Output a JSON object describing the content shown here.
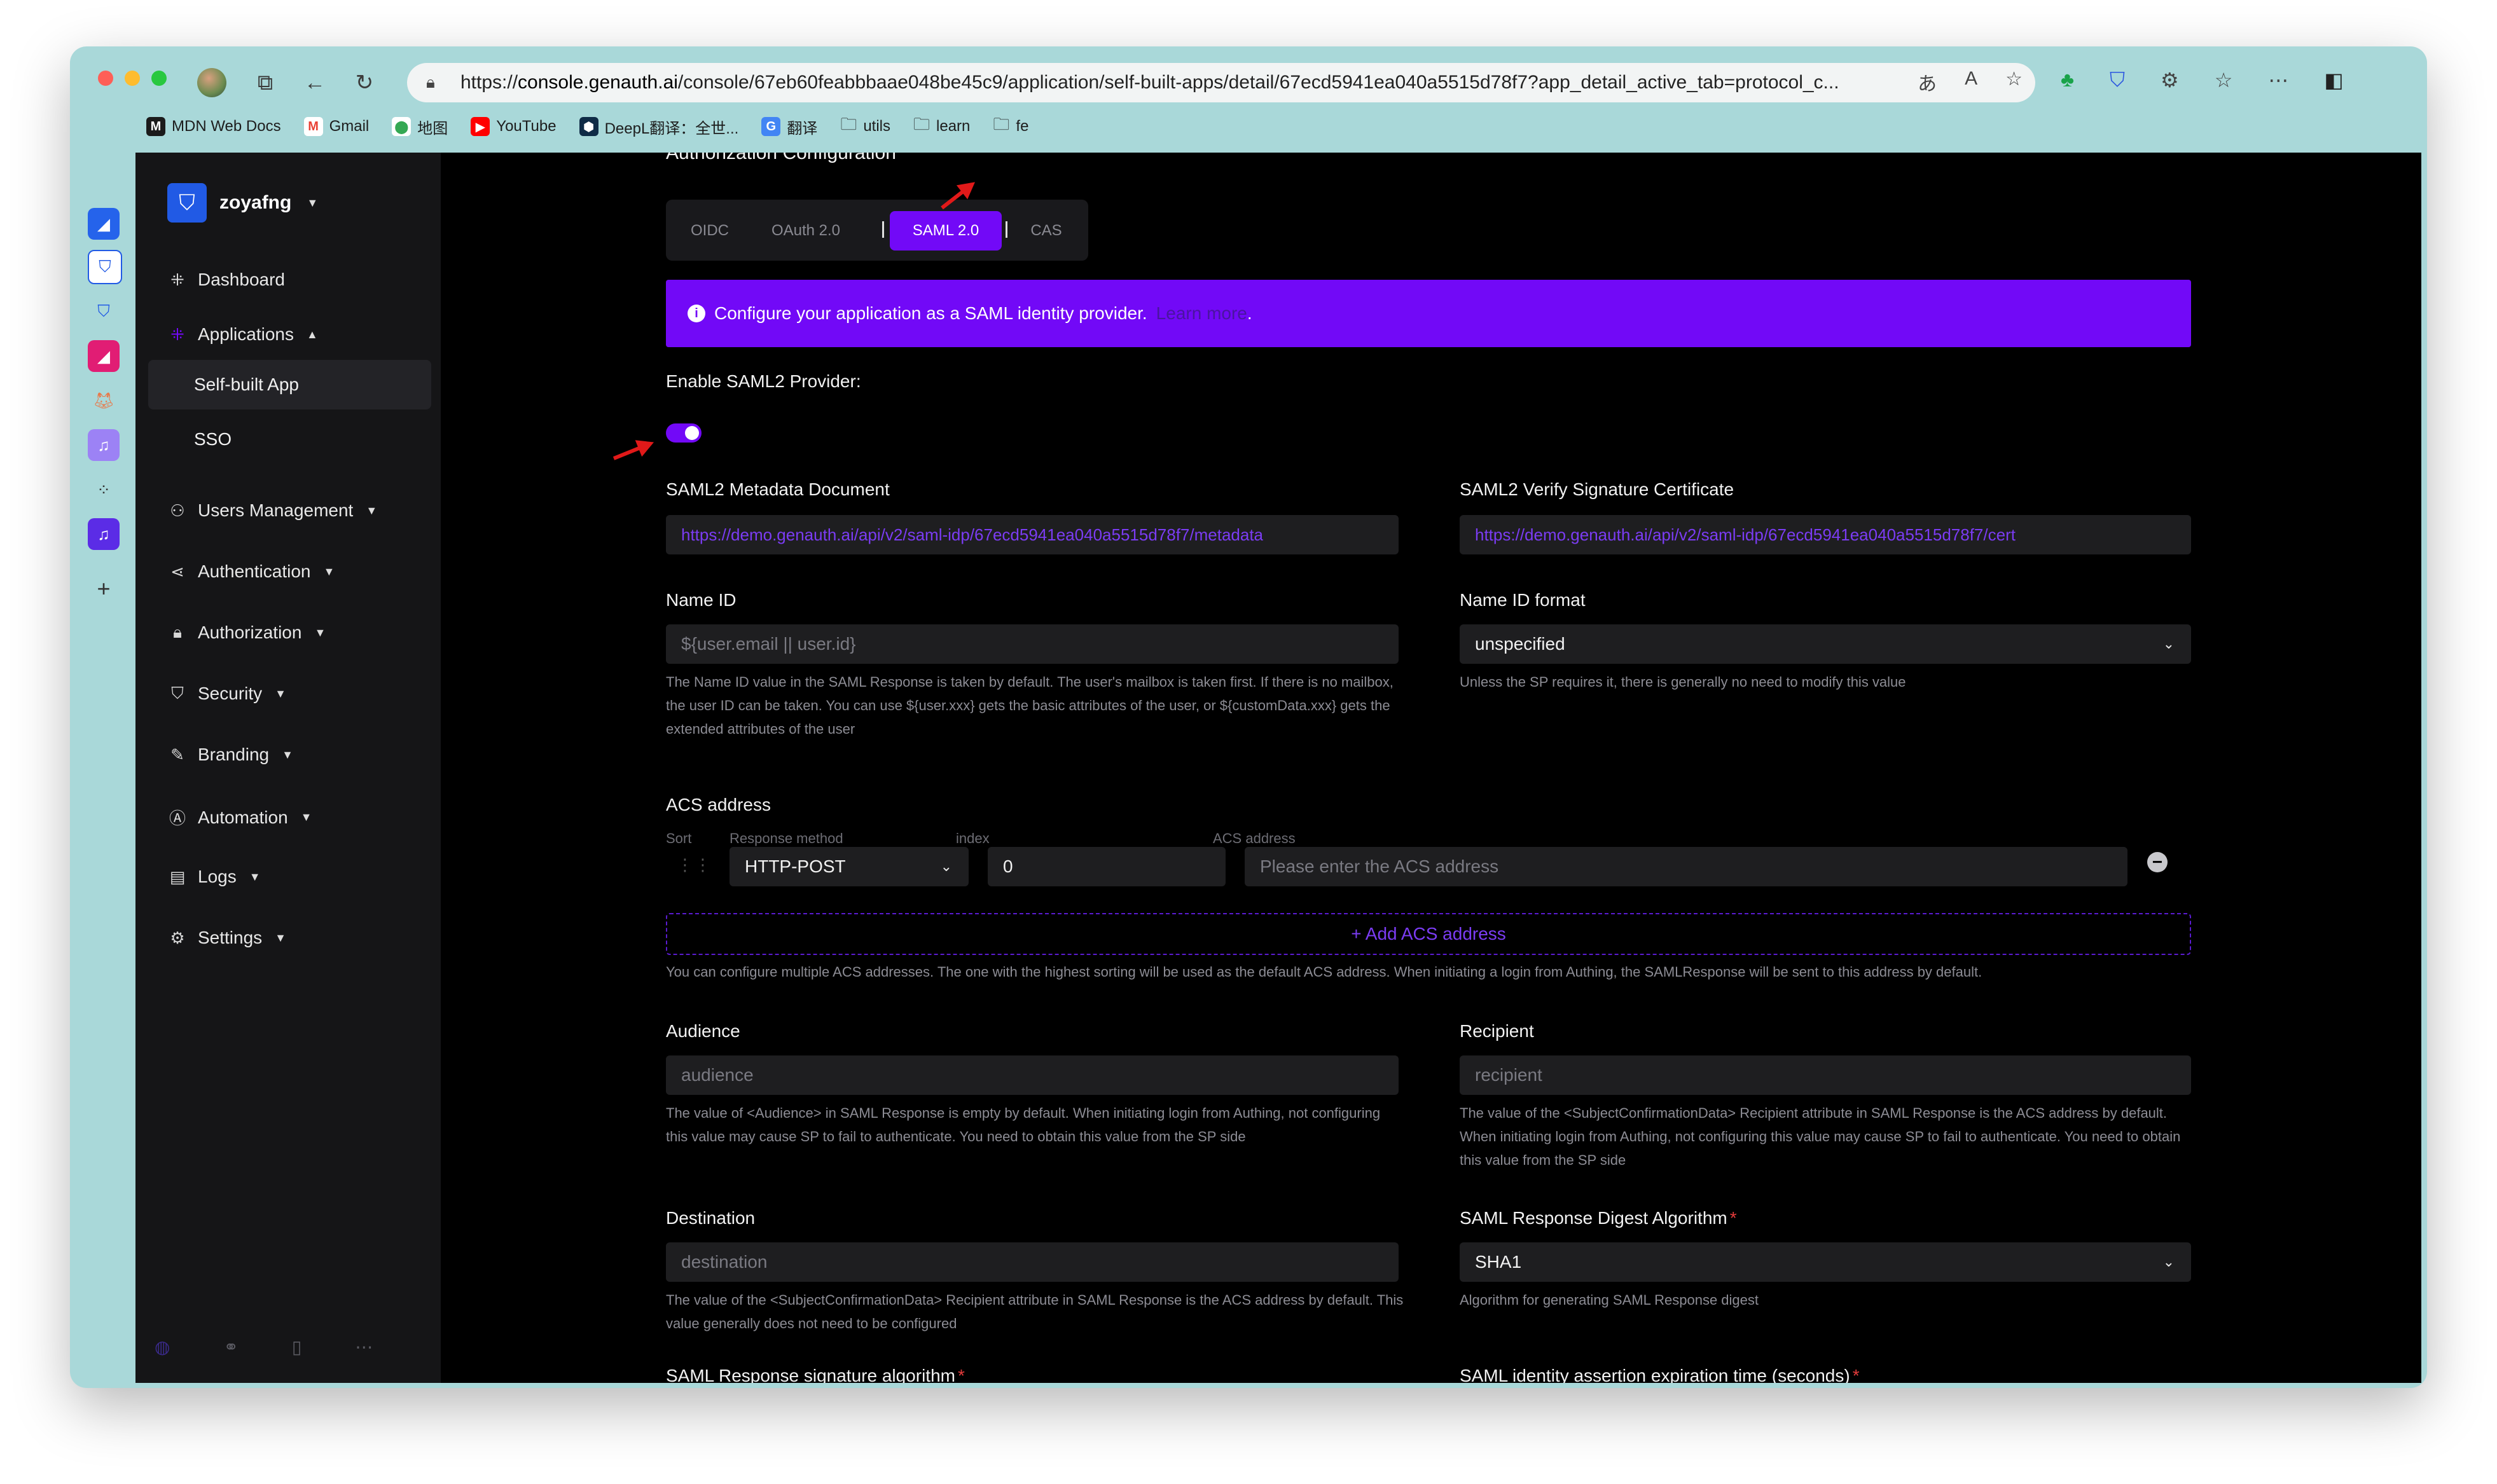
{
  "browser": {
    "url_prefix": "https://",
    "url_domain": "console.genauth.ai",
    "url_path": "/console/67eb60feabbbaae048be45c9/application/self-built-apps/detail/67ecd5941ea040a5515d78f7?app_detail_active_tab=protocol_c...",
    "bookmarks": [
      {
        "label": "MDN Web Docs",
        "icon": "M",
        "color": "#1b1b1b"
      },
      {
        "label": "Gmail",
        "icon": "M",
        "color": "#e94235"
      },
      {
        "label": "地图",
        "icon": "⬤",
        "color": "#34a853"
      },
      {
        "label": "YouTube",
        "icon": "▶",
        "color": "#ff0000"
      },
      {
        "label": "DeepL翻译：全世...",
        "icon": "⬢",
        "color": "#0f2b46"
      },
      {
        "label": "翻译",
        "icon": "G",
        "color": "#4285f4"
      },
      {
        "label": "utils",
        "icon": "",
        "color": ""
      },
      {
        "label": "learn",
        "icon": "",
        "color": ""
      },
      {
        "label": "fe",
        "icon": "",
        "color": ""
      }
    ]
  },
  "sidebar": {
    "org_name": "zoyafng",
    "items": {
      "dashboard": "Dashboard",
      "applications": "Applications",
      "self_built": "Self-built App",
      "sso": "SSO",
      "users": "Users Management",
      "authentication": "Authentication",
      "authorization": "Authorization",
      "security": "Security",
      "branding": "Branding",
      "automation": "Automation",
      "logs": "Logs",
      "settings": "Settings"
    }
  },
  "page": {
    "section_title": "Authorization Configuration",
    "tabs": {
      "oidc": "OIDC",
      "oauth": "OAuth 2.0",
      "saml": "SAML 2.0",
      "cas": "CAS"
    },
    "banner_text": "Configure your application as a SAML identity provider.",
    "banner_link": "Learn more",
    "banner_period": ".",
    "enable_label": "Enable SAML2 Provider:",
    "metadata_label": "SAML2 Metadata Document",
    "metadata_value": "https://demo.genauth.ai/api/v2/saml-idp/67ecd5941ea040a5515d78f7/metadata",
    "cert_label": "SAML2 Verify Signature Certificate",
    "cert_value": "https://demo.genauth.ai/api/v2/saml-idp/67ecd5941ea040a5515d78f7/cert",
    "nameid_label": "Name ID",
    "nameid_placeholder": "${user.email || user.id}",
    "nameid_hint": "The Name ID value in the SAML Response is taken by default. The user's mailbox is taken first. If there is no mailbox, the user ID can be taken. You can use ${user.xxx} gets the basic attributes of the user, or ${customData.xxx} gets the extended attributes of the user",
    "nameid_format_label": "Name ID format",
    "nameid_format_value": "unspecified",
    "nameid_format_hint": "Unless the SP requires it, there is generally no need to modify this value",
    "acs_label": "ACS address",
    "acs_col_sort": "Sort",
    "acs_col_method": "Response method",
    "acs_col_index": "index",
    "acs_col_address": "ACS address",
    "acs_method_value": "HTTP-POST",
    "acs_index_value": "0",
    "acs_address_placeholder": "Please enter the ACS address",
    "add_acs": "+ Add ACS address",
    "acs_hint": "You can configure multiple ACS addresses. The one with the highest sorting will be used as the default ACS address. When initiating a login from Authing, the SAMLResponse will be sent to this address by default.",
    "audience_label": "Audience",
    "audience_placeholder": "audience",
    "audience_hint": "The value of <Audience> in SAML Response is empty by default. When initiating login from Authing, not configuring this value may cause SP to fail to authenticate. You need to obtain this value from the SP side",
    "recipient_label": "Recipient",
    "recipient_placeholder": "recipient",
    "recipient_hint": "The value of the <SubjectConfirmationData> Recipient attribute in SAML Response is the ACS address by default. When initiating login from Authing, not configuring this value may cause SP to fail to authenticate. You need to obtain this value from the SP side",
    "destination_label": "Destination",
    "destination_placeholder": "destination",
    "destination_hint": "The value of the <SubjectConfirmationData> Recipient attribute in SAML Response is the ACS address by default. This value generally does not need to be configured",
    "digest_label": "SAML Response Digest Algorithm",
    "digest_value": "SHA1",
    "digest_hint": "Algorithm for generating SAML Response digest",
    "sig_alg_label": "SAML Response signature algorithm",
    "expiry_label": "SAML identity assertion expiration time (seconds)",
    "required_mark": "*"
  },
  "colors": {
    "accent": "#7209f7",
    "sidebar_bg": "#151517",
    "page_bg": "#000000",
    "annotation_arrow": "#e11919"
  }
}
